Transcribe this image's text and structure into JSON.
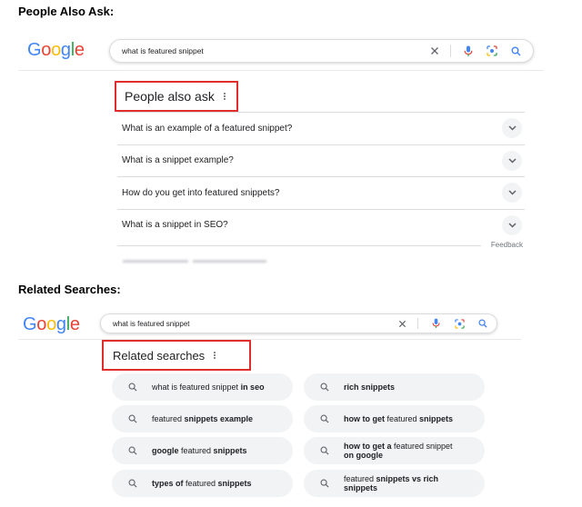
{
  "headings": {
    "paa": "People Also Ask:",
    "related": "Related Searches:"
  },
  "logo": [
    "G",
    "o",
    "o",
    "g",
    "l",
    "e"
  ],
  "search_top": {
    "query": "what is featured snippet"
  },
  "search_bottom": {
    "query": "what is featured snippet"
  },
  "paa": {
    "title": "People also ask",
    "questions": [
      "What is an example of a featured snippet?",
      "What is a snippet example?",
      "How do you get into featured snippets?",
      "What is a snippet in SEO?"
    ],
    "feedback": "Feedback"
  },
  "related": {
    "title": "Related searches",
    "chips": [
      [
        {
          "t": "what is featured snippet ",
          "b": false
        },
        {
          "t": "in seo",
          "b": true
        }
      ],
      [
        {
          "t": "rich snippets",
          "b": true
        }
      ],
      [
        {
          "t": "featured ",
          "b": false
        },
        {
          "t": "snippets example",
          "b": true
        }
      ],
      [
        {
          "t": "how to get",
          "b": true
        },
        {
          "t": " featured ",
          "b": false
        },
        {
          "t": "snippets",
          "b": true
        }
      ],
      [
        {
          "t": "google",
          "b": true
        },
        {
          "t": " featured ",
          "b": false
        },
        {
          "t": "snippets",
          "b": true
        }
      ],
      [
        {
          "t": "how to get a",
          "b": true
        },
        {
          "t": " featured snippet\n",
          "b": false
        },
        {
          "t": "on google",
          "b": true
        }
      ],
      [
        {
          "t": "types of",
          "b": true
        },
        {
          "t": " featured ",
          "b": false
        },
        {
          "t": "snippets",
          "b": true
        }
      ],
      [
        {
          "t": "featured ",
          "b": false
        },
        {
          "t": "snippets vs rich\nsnippets",
          "b": true
        }
      ]
    ]
  },
  "icons": {
    "clear": "close-icon",
    "voice": "microphone-icon",
    "lens": "google-lens-icon",
    "search": "search-icon",
    "more": "more-vert-icon",
    "expand": "chevron-down-icon"
  },
  "colors": {
    "highlight_box": "#e02d2d",
    "chip_bg": "#f1f3f4",
    "google_blue": "#4285f4",
    "google_red": "#ea4335",
    "google_yellow": "#fbbc05",
    "google_green": "#34a853"
  }
}
